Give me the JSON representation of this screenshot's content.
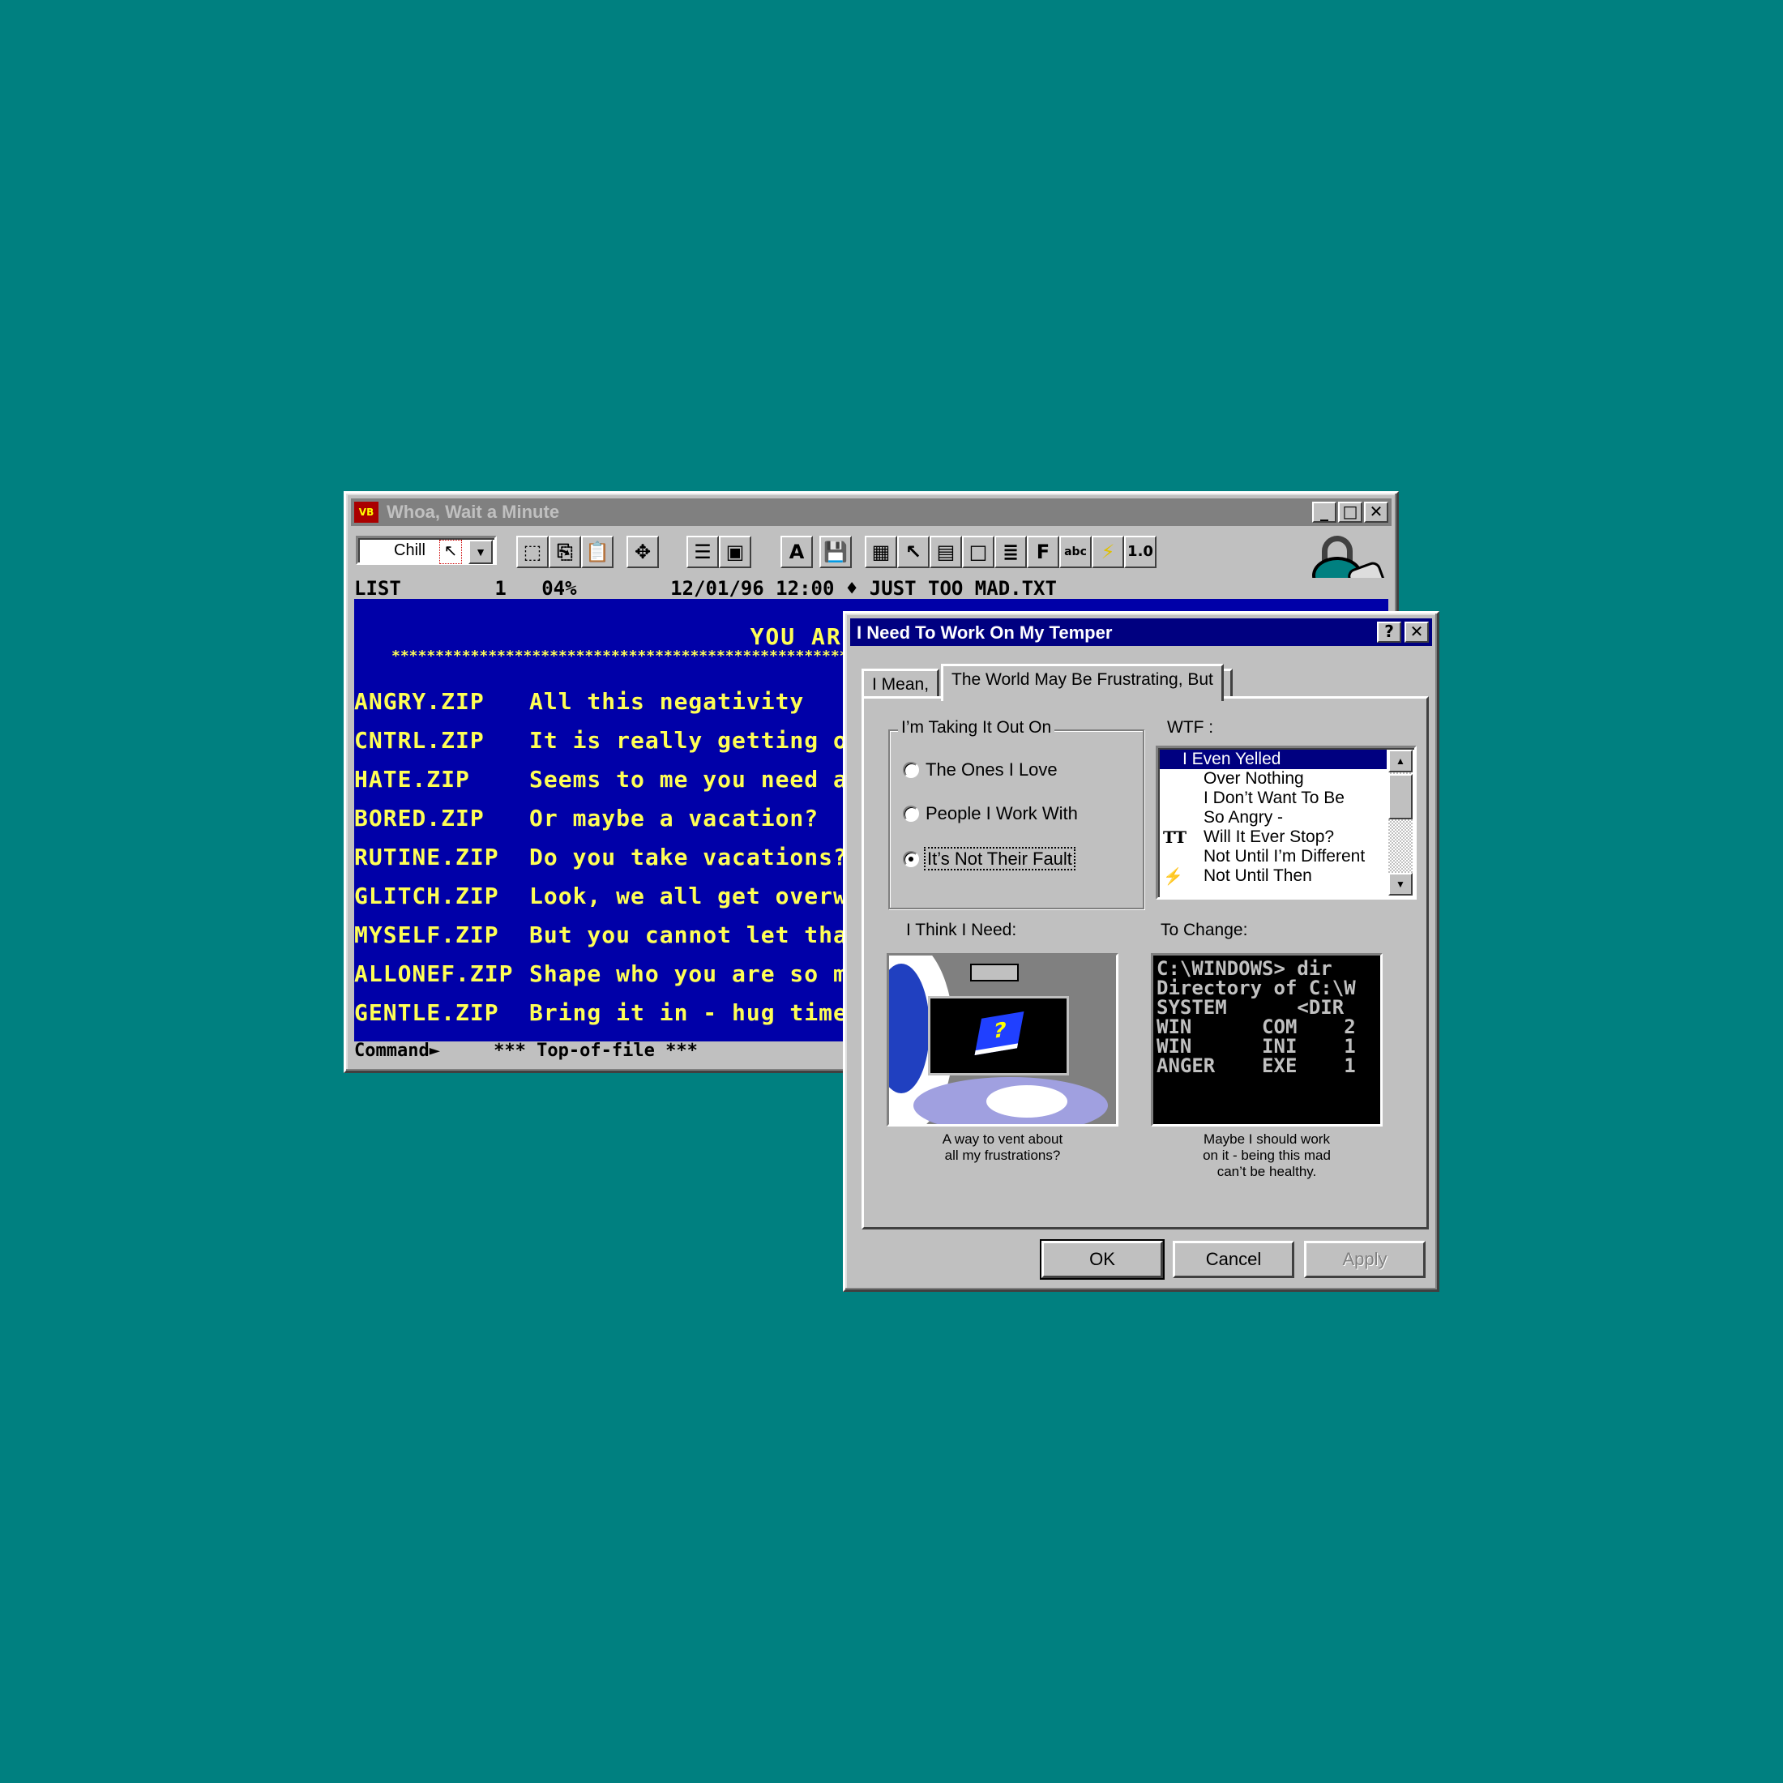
{
  "win1": {
    "title": "Whoa, Wait a Minute",
    "combo_value": "Chill",
    "toolbar_text_btn": "1.0",
    "status_line": "LIST        1   04%        12/01/96 12:00 ♦ JUST TOO MAD.TXT",
    "heading": "YOU ARE TOO MAD",
    "stars": "******************************************************************************************",
    "rows": [
      {
        "file": "ANGRY.ZIP",
        "text": "All this negativity"
      },
      {
        "file": "CNTRL.ZIP",
        "text": "It is really getting o"
      },
      {
        "file": "HATE.ZIP",
        "text": "Seems to me you need a"
      },
      {
        "file": "BORED.ZIP",
        "text": "Or maybe a vacation?"
      },
      {
        "file": "RUTINE.ZIP",
        "text": "Do you take vacations?"
      },
      {
        "file": "GLITCH.ZIP",
        "text": "Look, we all get overw"
      },
      {
        "file": "MYSELF.ZIP",
        "text": "But you cannot let tha"
      },
      {
        "file": "ALLONEF.ZIP",
        "text": "Shape who you are so m"
      },
      {
        "file": "GENTLE.ZIP",
        "text": "Bring it in - hug time"
      }
    ],
    "command_line": "Command►     *** Top-of-file ***"
  },
  "dialog": {
    "title": "I Need To Work On My Temper",
    "tabs": [
      "I Mean,",
      "The World May Be Frustrating, But"
    ],
    "group_label": "I’m Taking It Out On",
    "radios": [
      "The Ones I Love",
      "People I Work With",
      "It’s Not Their Fault"
    ],
    "selected_radio": "It’s Not Their Fault",
    "list_label": "WTF :",
    "list_items": [
      "I Even Yelled",
      "Over Nothing",
      "I Don’t Want To Be",
      "So Angry -",
      "Will It Ever Stop?",
      "Not Until I’m Different",
      "Not Until Then"
    ],
    "list_selected": "I Even Yelled",
    "left_label": "I Think I Need:",
    "right_label": "To Change:",
    "dos_lines": [
      "C:\\WINDOWS> dir",
      "Directory of C:\\W",
      "SYSTEM      <DIR",
      "WIN      COM    2",
      "WIN      INI    1",
      "ANGER    EXE    1"
    ],
    "caption_left_1": "A way to vent about",
    "caption_left_2": "all my frustrations?",
    "caption_right_1": "Maybe I should work",
    "caption_right_2": "on it - being this mad",
    "caption_right_3": "can’t be healthy.",
    "ok": "OK",
    "cancel": "Cancel",
    "apply": "Apply",
    "help_btn": "?",
    "close_btn": "✕"
  },
  "colors": {
    "desktop": "#008080",
    "terminal_bg": "#0000a8",
    "terminal_text": "#ffff55",
    "active_title": "#000080",
    "inactive_title": "#808080"
  }
}
